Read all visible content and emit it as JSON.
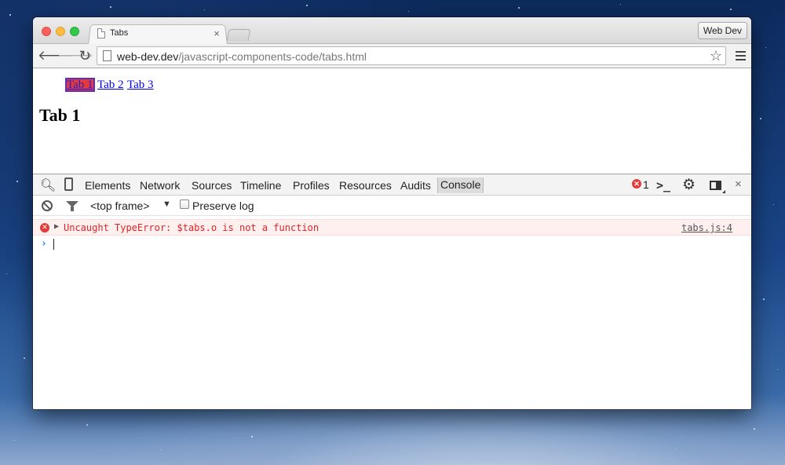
{
  "browser": {
    "tab_title": "Tabs",
    "tab_close": "×",
    "profile_label": "Web Dev",
    "url_host": "web-dev.dev",
    "url_path": "/javascript-components-code/tabs.html"
  },
  "page": {
    "tabs": [
      "Tab 1",
      "Tab 2",
      "Tab 3"
    ],
    "active_tab": "Tab 1",
    "heading": "Tab 1"
  },
  "devtools": {
    "panels": [
      "Elements",
      "Network",
      "Sources",
      "Timeline",
      "Profiles",
      "Resources",
      "Audits",
      "Console"
    ],
    "selected_panel": "Console",
    "error_count": "1",
    "frame_select": "<top frame>",
    "preserve_log_label": "Preserve log",
    "preserve_log_checked": false,
    "console": {
      "error_message": "Uncaught TypeError: $tabs.o is not a function",
      "error_source": "tabs.js:4",
      "prompt": "›"
    },
    "close_label": "×"
  },
  "colors": {
    "error_red": "#e33b3b",
    "error_bg": "#fff0f0",
    "link_blue": "#0000ee",
    "active_tab_bg": "#e23a3a"
  }
}
